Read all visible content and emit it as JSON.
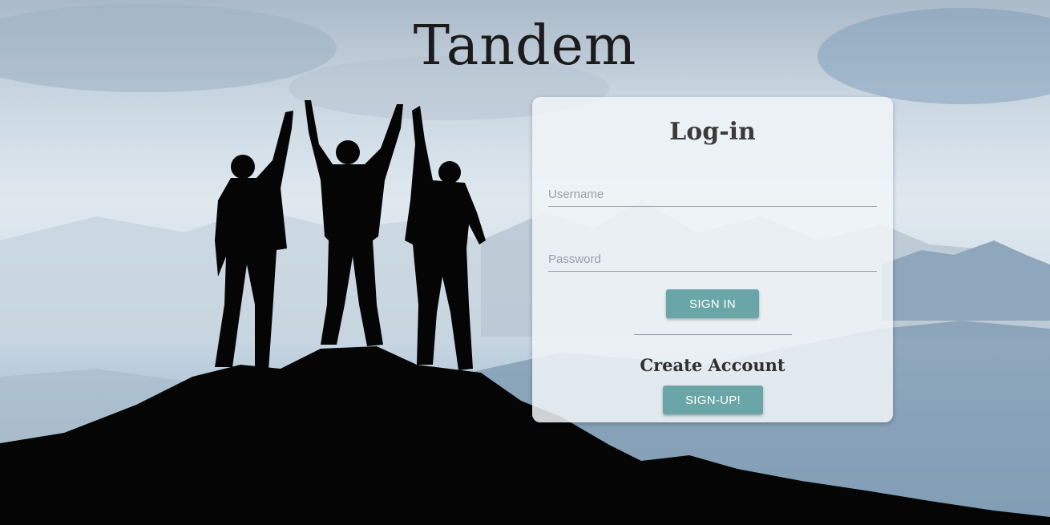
{
  "app": {
    "title": "Tandem"
  },
  "login": {
    "title": "Log-in",
    "username_placeholder": "Username",
    "password_placeholder": "Password",
    "signin_label": "SIGN IN",
    "create_account_label": "Create Account",
    "signup_label": "SIGN-UP!"
  },
  "colors": {
    "button": "#6aa6a7",
    "title_text": "#1b1b1b"
  },
  "icons": {
    "background": "mountain-summit-silhouette-image"
  }
}
